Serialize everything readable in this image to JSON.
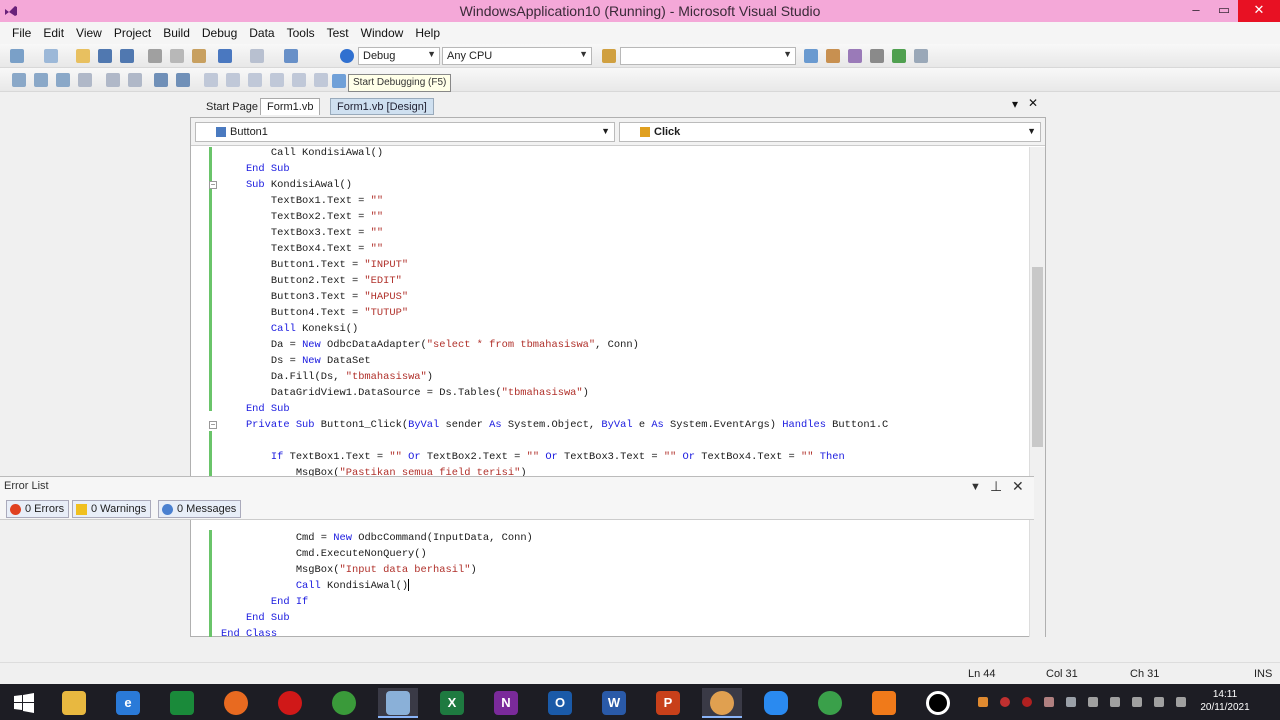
{
  "window": {
    "title": "WindowsApplication10 (Running) - Microsoft Visual Studio",
    "controls": [
      "–",
      "▭",
      "✕"
    ]
  },
  "menu": [
    "File",
    "Edit",
    "View",
    "Project",
    "Build",
    "Debug",
    "Data",
    "Tools",
    "Test",
    "Window",
    "Help"
  ],
  "toolbar": {
    "config": "Debug",
    "platform": "Any CPU",
    "tooltip": "Start Debugging (F5)"
  },
  "tabs": {
    "items": [
      "Start Page",
      "Form1.vb",
      "Form1.vb [Design]"
    ],
    "dropdown": "▾",
    "close": "✕"
  },
  "editor": {
    "object_combo": "Button1",
    "method_combo": "Click",
    "lines": [
      [
        [
          "plain",
          "        Call KondisiAwal()"
        ]
      ],
      [
        [
          "kw",
          "    End Sub"
        ]
      ],
      [
        [
          "kw",
          "    Sub "
        ],
        [
          "plain",
          "KondisiAwal()"
        ]
      ],
      [
        [
          "plain",
          "        TextBox1.Text = "
        ],
        [
          "str",
          "\"\""
        ]
      ],
      [
        [
          "plain",
          "        TextBox2.Text = "
        ],
        [
          "str",
          "\"\""
        ]
      ],
      [
        [
          "plain",
          "        TextBox3.Text = "
        ],
        [
          "str",
          "\"\""
        ]
      ],
      [
        [
          "plain",
          "        TextBox4.Text = "
        ],
        [
          "str",
          "\"\""
        ]
      ],
      [
        [
          "plain",
          "        Button1.Text = "
        ],
        [
          "str",
          "\"INPUT\""
        ]
      ],
      [
        [
          "plain",
          "        Button2.Text = "
        ],
        [
          "str",
          "\"EDIT\""
        ]
      ],
      [
        [
          "plain",
          "        Button3.Text = "
        ],
        [
          "str",
          "\"HAPUS\""
        ]
      ],
      [
        [
          "plain",
          "        Button4.Text = "
        ],
        [
          "str",
          "\"TUTUP\""
        ]
      ],
      [
        [
          "kw",
          "        Call "
        ],
        [
          "plain",
          "Koneksi()"
        ]
      ],
      [
        [
          "plain",
          "        Da = "
        ],
        [
          "kw",
          "New "
        ],
        [
          "plain",
          "OdbcDataAdapter("
        ],
        [
          "str",
          "\"select * from tbmahasiswa\""
        ],
        [
          "plain",
          ", Conn)"
        ]
      ],
      [
        [
          "plain",
          "        Ds = "
        ],
        [
          "kw",
          "New "
        ],
        [
          "plain",
          "DataSet"
        ]
      ],
      [
        [
          "plain",
          "        Da.Fill(Ds, "
        ],
        [
          "str",
          "\"tbmahasiswa\""
        ],
        [
          "plain",
          ")"
        ]
      ],
      [
        [
          "plain",
          "        DataGridView1.DataSource = Ds.Tables("
        ],
        [
          "str",
          "\"tbmahasiswa\""
        ],
        [
          "plain",
          ")"
        ]
      ],
      [
        [
          "kw",
          "    End Sub"
        ]
      ],
      [
        [
          "kw",
          "    Private Sub "
        ],
        [
          "plain",
          "Button1_Click("
        ],
        [
          "kw",
          "ByVal "
        ],
        [
          "plain",
          "sender "
        ],
        [
          "kw",
          "As "
        ],
        [
          "plain",
          "System.Object, "
        ],
        [
          "kw",
          "ByVal "
        ],
        [
          "plain",
          "e "
        ],
        [
          "kw",
          "As "
        ],
        [
          "plain",
          "System.EventArgs) "
        ],
        [
          "kw",
          "Handles "
        ],
        [
          "plain",
          "Button1.C"
        ]
      ],
      [
        [
          "plain",
          ""
        ]
      ],
      [
        [
          "kw",
          "        If "
        ],
        [
          "plain",
          "TextBox1.Text = "
        ],
        [
          "str",
          "\"\" "
        ],
        [
          "kw",
          "Or "
        ],
        [
          "plain",
          "TextBox2.Text = "
        ],
        [
          "str",
          "\"\" "
        ],
        [
          "kw",
          "Or "
        ],
        [
          "plain",
          "TextBox3.Text = "
        ],
        [
          "str",
          "\"\" "
        ],
        [
          "kw",
          "Or "
        ],
        [
          "plain",
          "TextBox4.Text = "
        ],
        [
          "str",
          "\"\" "
        ],
        [
          "kw",
          "Then"
        ]
      ],
      [
        [
          "plain",
          "            MsgBox("
        ],
        [
          "str",
          "\"Pastikan semua field terisi\""
        ],
        [
          "plain",
          ")"
        ]
      ]
    ],
    "lines_after": [
      [
        [
          "plain",
          "            Cmd = "
        ],
        [
          "kw",
          "New "
        ],
        [
          "plain",
          "OdbcCommand(InputData, Conn)"
        ]
      ],
      [
        [
          "plain",
          "            Cmd.ExecuteNonQuery()"
        ]
      ],
      [
        [
          "plain",
          "            MsgBox("
        ],
        [
          "str",
          "\"Input data berhasil\""
        ],
        [
          "plain",
          ")"
        ]
      ],
      [
        [
          "kw",
          "            Call "
        ],
        [
          "plain",
          "KondisiAwal()"
        ]
      ],
      [
        [
          "kw",
          "        End If"
        ]
      ],
      [
        [
          "kw",
          "    End Sub"
        ]
      ],
      [
        [
          "kw",
          "End Class"
        ]
      ]
    ]
  },
  "error_list": {
    "title": "Error List",
    "errors": "0 Errors",
    "warnings": "0 Warnings",
    "messages": "0 Messages"
  },
  "status": {
    "ln": "Ln 44",
    "col": "Col 31",
    "ch": "Ch 31",
    "mode": "INS"
  },
  "taskbar": {
    "time": "14:11",
    "date": "20/11/2021"
  },
  "colors": {
    "keyword": "#1a1adf",
    "string": "#b0302a",
    "titlebar": "#f4a8d8"
  }
}
